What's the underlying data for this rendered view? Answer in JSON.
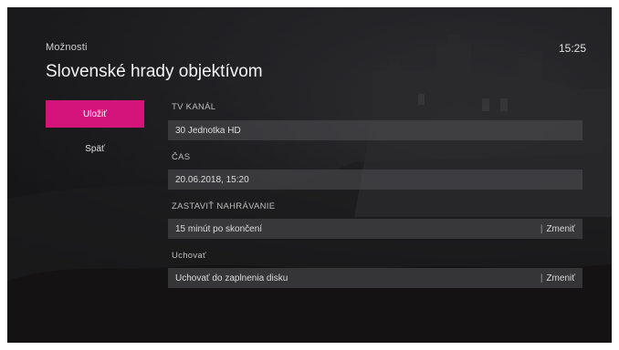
{
  "header": {
    "section": "Možnosti",
    "title": "Slovenské hrady objektívom",
    "clock": "15:25"
  },
  "menu": {
    "items": [
      {
        "label": "Uložiť",
        "active": true
      },
      {
        "label": "Späť",
        "active": false
      }
    ]
  },
  "fields": {
    "channel_label": "TV KANÁL",
    "channel_value": "30 Jednotka HD",
    "time_label": "ČAS",
    "time_value": "20.06.2018, 15:20",
    "stop_label": "ZASTAVIŤ NAHRÁVANIE",
    "stop_value": "15 minút po skončení",
    "stop_action": "Zmeniť",
    "keep_label": "Uchovať",
    "keep_value": "Uchovať do zaplnenia disku",
    "keep_action": "Zmeniť"
  },
  "colors": {
    "accent": "#d4137b"
  }
}
